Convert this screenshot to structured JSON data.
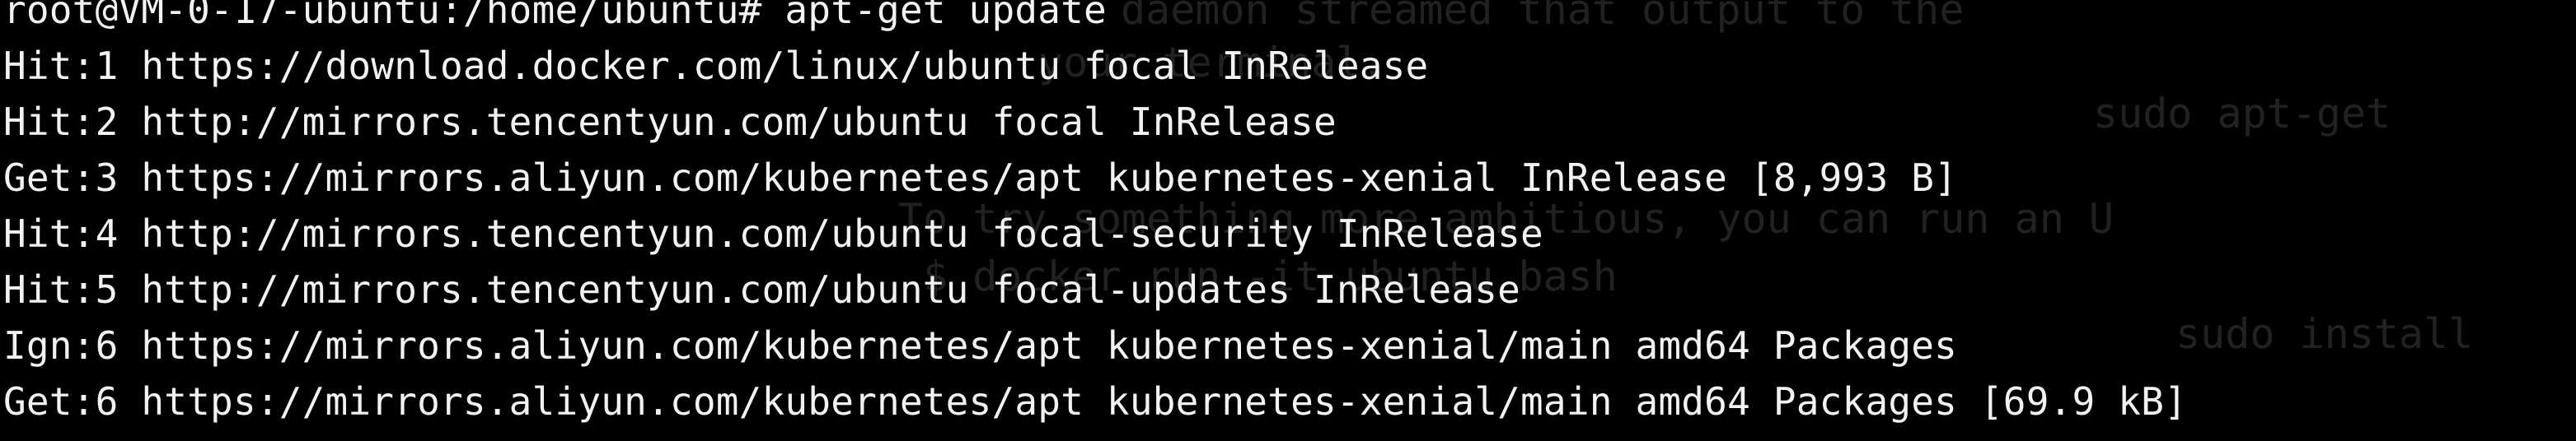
{
  "terminal": {
    "prompt_line": "root@VM-0-17-ubuntu:/home/ubuntu# apt-get update",
    "output": [
      "Hit:1 https://download.docker.com/linux/ubuntu focal InRelease",
      "Hit:2 http://mirrors.tencentyun.com/ubuntu focal InRelease",
      "Get:3 https://mirrors.aliyun.com/kubernetes/apt kubernetes-xenial InRelease [8,993 B]",
      "Hit:4 http://mirrors.tencentyun.com/ubuntu focal-security InRelease",
      "Hit:5 http://mirrors.tencentyun.com/ubuntu focal-updates InRelease",
      "Ign:6 https://mirrors.aliyun.com/kubernetes/apt kubernetes-xenial/main amd64 Packages",
      "Get:6 https://mirrors.aliyun.com/kubernetes/apt kubernetes-xenial/main amd64 Packages [69.9 kB]"
    ],
    "background_text": [
      "daemon streamed that output to the",
      "your terminal.",
      "sudo apt-get",
      "To try something more ambitious, you can run an U",
      "$ docker run -it ubuntu bash",
      "sudo install"
    ]
  }
}
